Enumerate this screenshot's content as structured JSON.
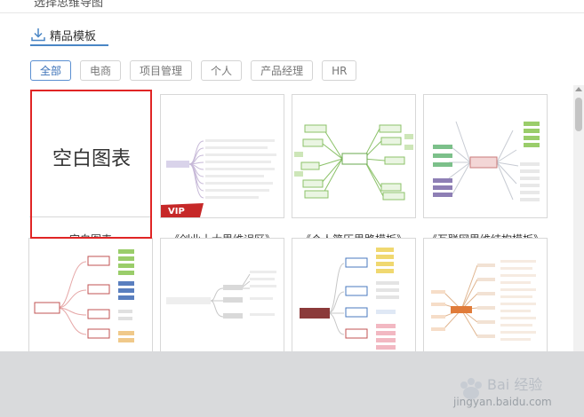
{
  "dialog": {
    "cut_title": "选择思维导图"
  },
  "tab": {
    "label": "精品模板"
  },
  "filters": [
    "全部",
    "电商",
    "项目管理",
    "个人",
    "产品经理",
    "HR"
  ],
  "cards": [
    {
      "label": "空白图表",
      "thumb_text": "空白图表"
    },
    {
      "label": "《创业十大思维误区》",
      "badge": "VIP"
    },
    {
      "label": "《个人简历思路模板》"
    },
    {
      "label": "《互联网思维结构模板》"
    }
  ],
  "colors": {
    "accent": "#4a86c5",
    "selection": "#e02525",
    "vip": "#c62828"
  },
  "watermark": {
    "text": "jingyan.baidu.com",
    "logo_text": "Bai 经验"
  }
}
